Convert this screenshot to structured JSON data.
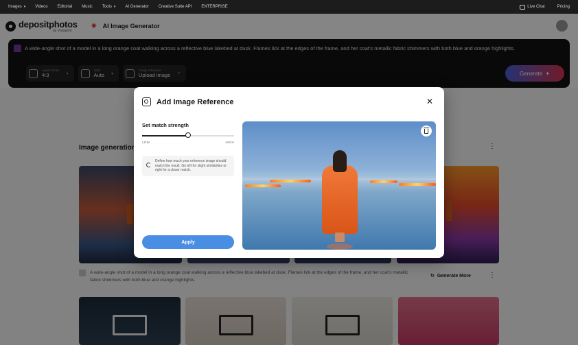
{
  "topnav": {
    "items": [
      {
        "label": "Images",
        "caret": true
      },
      {
        "label": "Videos",
        "caret": false
      },
      {
        "label": "Editorial",
        "caret": false
      },
      {
        "label": "Music",
        "caret": false
      },
      {
        "label": "Tools",
        "caret": true
      },
      {
        "label": "AI Generator",
        "caret": false
      },
      {
        "label": "Creative Suite API",
        "caret": false
      },
      {
        "label": "ENTERPRISE",
        "caret": false
      }
    ],
    "live_chat": "Live Chat",
    "pricing": "Pricing"
  },
  "header": {
    "logo_name": "depositphotos",
    "logo_by": "by Vistaprint",
    "page_title": "AI Image Generator"
  },
  "prompt": {
    "text": "A wide-angle shot of a model in a long orange coat walking across a reflective blue lakebed at dusk. Flames lick at the edges of the frame, and her coat's metallic fabric shimmers with both blue and orange highlights.",
    "options": [
      {
        "label": "Aspect Ratio",
        "value": "4:3",
        "icon": "aspect-ratio-icon"
      },
      {
        "label": "Style",
        "value": "Auto",
        "icon": "style-icon"
      },
      {
        "label": "Image reference",
        "value": "Upload image",
        "icon": "image-reference-icon"
      }
    ],
    "generate_label": "Generate"
  },
  "results": {
    "section_title": "Image generation",
    "caption": "A wide-angle shot of a model in a long orange coat walking across a reflective blue lakebed at dusk. Flames lick at the edges of the frame, and her coat's metallic fabric shimmers with both blue and orange highlights.",
    "generate_more_label": "Generate More"
  },
  "modal": {
    "title": "Add Image Reference",
    "strength_title": "Set match strength",
    "low_label": "LOW",
    "high_label": "HIGH",
    "strength_value": 0.5,
    "hint": "Define how much your reference image should match the result. Go left for slight similarities or right for a closer match.",
    "apply_label": "Apply",
    "icons": {
      "header": "image-reference-icon",
      "close": "close-icon",
      "delete": "trash-icon",
      "hint": "refresh-icon"
    }
  }
}
